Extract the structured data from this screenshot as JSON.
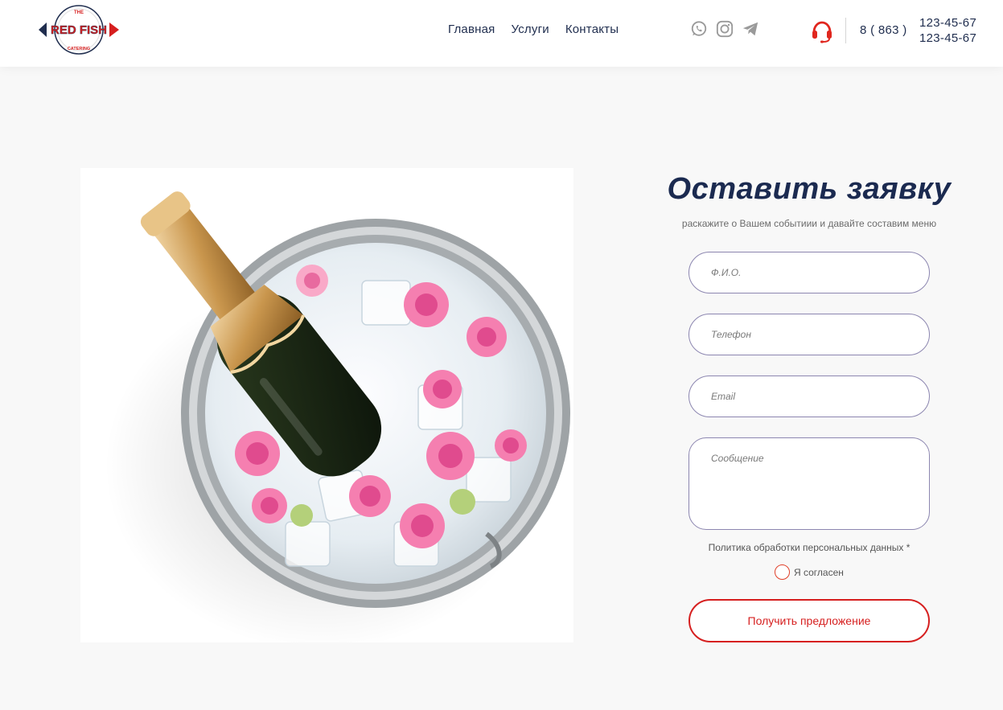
{
  "header": {
    "logo": {
      "top_text": "THE",
      "main_text": "RED FISH",
      "bottom_text": "CATERING",
      "icon": "red-fish-logo-icon"
    },
    "nav": [
      {
        "label": "Главная"
      },
      {
        "label": "Услуги"
      },
      {
        "label": "Контакты"
      }
    ],
    "socials": [
      {
        "icon": "whatsapp-icon"
      },
      {
        "icon": "instagram-icon"
      },
      {
        "icon": "telegram-icon"
      }
    ],
    "support_icon": "headset-icon",
    "phone": {
      "prefix": "8 ( 863 )",
      "numbers": [
        "123-45-67",
        "123-45-67"
      ]
    }
  },
  "main": {
    "photo": {
      "alt": "champagne bottle in ice bucket with frozen roses"
    },
    "form": {
      "title": "Оставить заявку",
      "subtitle": "раскажите о Вашем событиии и давайте составим меню",
      "fields": {
        "name_placeholder": "Ф.И.О.",
        "phone_placeholder": "Телефон",
        "email_placeholder": "Email",
        "message_placeholder": "Сообщение"
      },
      "policy_label": "Политика обработки персональных данных *",
      "consent_label": "Я согласен",
      "submit_label": "Получить предложение"
    }
  },
  "colors": {
    "navy": "#1f2d4e",
    "accent_red": "#d61f1f",
    "field_border": "#8c86b0",
    "background": "#f8f8f8"
  }
}
